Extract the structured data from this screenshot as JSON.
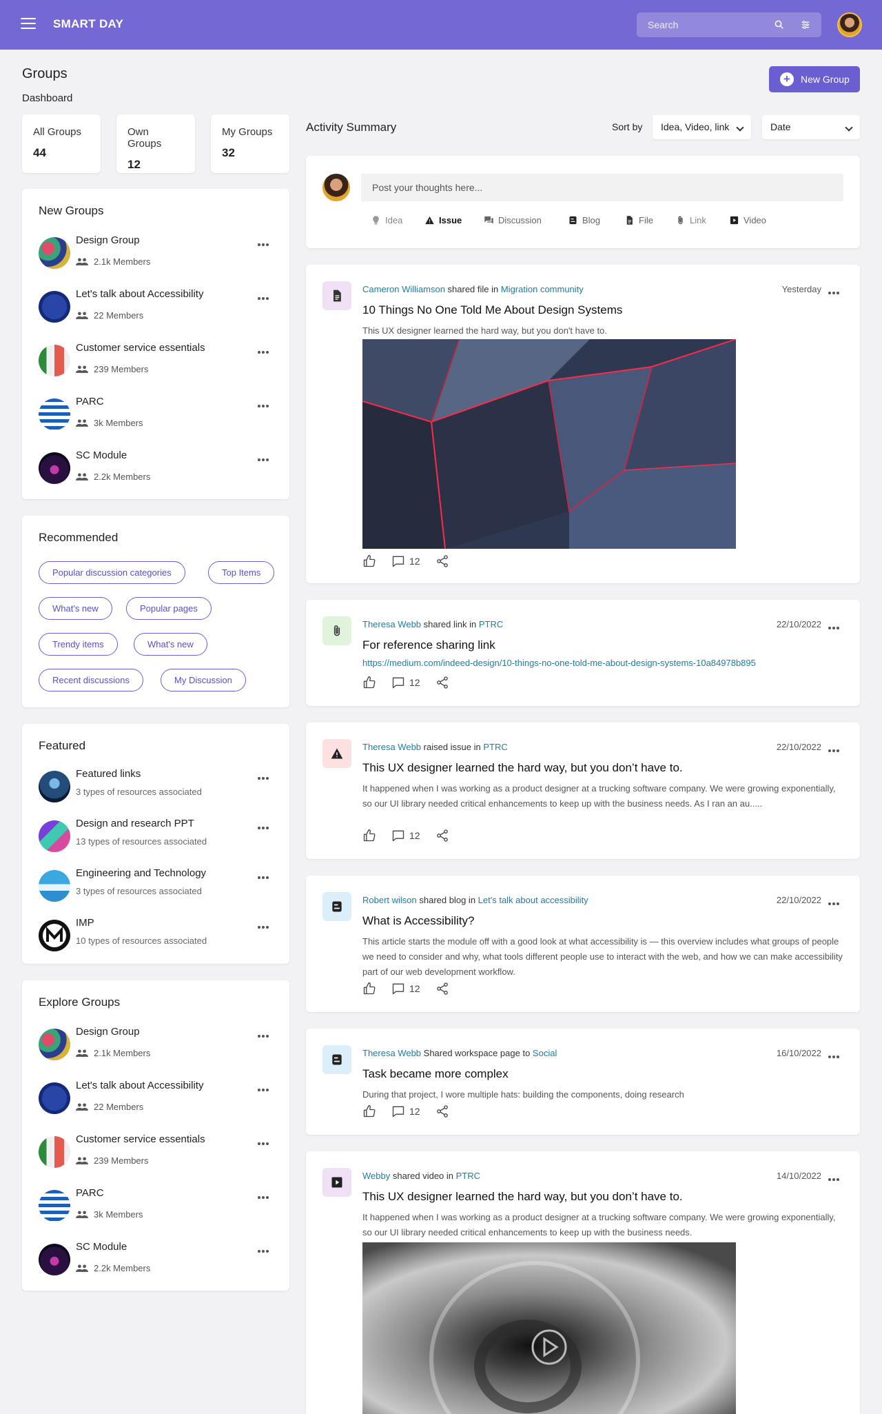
{
  "header": {
    "brand": "SMART DAY",
    "search_placeholder": "Search"
  },
  "page": {
    "title": "Groups",
    "subtitle": "Dashboard",
    "new_group_label": "New Group"
  },
  "stats": [
    {
      "label": "All Groups",
      "value": "44"
    },
    {
      "label": "Own Groups",
      "value": "12"
    },
    {
      "label": "My Groups",
      "value": "32"
    }
  ],
  "new_groups": {
    "title": "New Groups",
    "items": [
      {
        "name": "Design Group",
        "members": "2.1k Members"
      },
      {
        "name": "Let's talk about Accessibility",
        "members": "22 Members"
      },
      {
        "name": "Customer service essentials",
        "members": "239 Members"
      },
      {
        "name": "PARC",
        "members": "3k Members"
      },
      {
        "name": "SC Module",
        "members": "2.2k Members"
      }
    ]
  },
  "recommended": {
    "title": "Recommended",
    "chips": [
      "Popular discussion categories",
      "Top Items",
      "What's new",
      "Popular pages",
      "Trendy items",
      "What's new",
      "Recent discussions",
      "My Discussion"
    ]
  },
  "featured": {
    "title": "Featured",
    "items": [
      {
        "name": "Featured links",
        "meta": "3 types of resources associated"
      },
      {
        "name": "Design and research PPT",
        "meta": "13 types of resources associated"
      },
      {
        "name": "Engineering and Technology",
        "meta": "3 types of resources associated"
      },
      {
        "name": "IMP",
        "meta": "10 types of resources associated"
      }
    ]
  },
  "explore_groups": {
    "title": "Explore Groups",
    "items": [
      {
        "name": "Design Group",
        "members": "2.1k Members"
      },
      {
        "name": "Let's talk about Accessibility",
        "members": "22 Members"
      },
      {
        "name": "Customer service essentials",
        "members": "239 Members"
      },
      {
        "name": "PARC",
        "members": "3k Members"
      },
      {
        "name": "SC Module",
        "members": "2.2k Members"
      }
    ]
  },
  "activity": {
    "title": "Activity Summary",
    "sort_label": "Sort by",
    "sort_value": "Idea, Video, link",
    "date_value": "Date"
  },
  "composer": {
    "placeholder": "Post your thoughts here...",
    "types": [
      "Idea",
      "Issue",
      "Discussion",
      "Blog",
      "File",
      "Link",
      "Video"
    ],
    "active_type": "Issue"
  },
  "posts": [
    {
      "author": "Cameron Williamson",
      "action": " shared file in ",
      "target": "Migration community",
      "date": "Yesterday",
      "title": "10 Things No One Told Me About Design Systems",
      "desc": "This UX designer learned the hard way, but you don't have to.",
      "comments": "12"
    },
    {
      "author": "Theresa Webb",
      "action": " shared link in ",
      "target": "PTRC",
      "date": "22/10/2022",
      "title": "For reference sharing link",
      "link": "https://medium.com/indeed-design/10-things-no-one-told-me-about-design-systems-10a84978b895",
      "comments": "12"
    },
    {
      "author": "Theresa Webb",
      "action": " raised issue in ",
      "target": "PTRC",
      "date": "22/10/2022",
      "title": "This UX designer learned the hard way, but you don’t have to.",
      "desc": "It happened when I was working as a product designer at a trucking software company. We were growing exponentially, so our UI library needed critical enhancements to keep up with the business needs. As I ran an au.....",
      "comments": "12"
    },
    {
      "author": "Robert wilson",
      "action": " shared blog in ",
      "target": "Let's talk about accessibility",
      "date": "22/10/2022",
      "title": "What is Accessibility?",
      "desc": "This article starts the module off with a good look at what accessibility is — this overview includes what groups of people we need to consider and why, what tools different people use to interact with the web, and how we can make accessibility part of our web development workflow.",
      "comments": "12"
    },
    {
      "author": "Theresa Webb",
      "action": " Shared workspace page to ",
      "target": "Social",
      "date": "16/10/2022",
      "title": "Task became more complex",
      "desc": "During that project, I wore multiple hats: building the components, doing research",
      "comments": "12"
    },
    {
      "author": "Webby",
      "action": " shared video in ",
      "target": "PTRC",
      "date": "14/10/2022",
      "title": "This UX designer learned the hard way, but you don’t have to.",
      "desc": "It happened when I was working as a product designer at a trucking software company. We were growing exponentially, so our UI library needed critical enhancements to keep up with the business needs."
    }
  ],
  "colors": {
    "primary": "#7468d4",
    "button": "#6a5fd0",
    "link": "#1a7fa8"
  }
}
